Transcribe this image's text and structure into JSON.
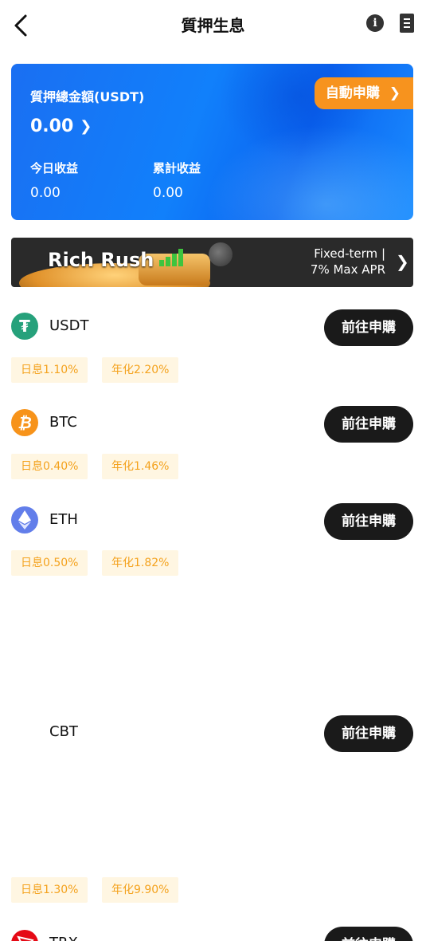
{
  "header": {
    "title": "質押生息"
  },
  "summary": {
    "total_label": "質押總金額(USDT)",
    "total_value": "0.00",
    "auto_button": "自動申購",
    "today_label": "今日收益",
    "today_value": "0.00",
    "cumulative_label": "累計收益",
    "cumulative_value": "0.00"
  },
  "banner": {
    "title": "Rich Rush",
    "line1": "Fixed-term |",
    "line2": "7% Max APR"
  },
  "coins": [
    {
      "name": "USDT",
      "icon": "tether-icon",
      "icon_color": "#26a17b",
      "button": "前往申購",
      "daily": "日息1.10%",
      "annual": "年化2.20%"
    },
    {
      "name": "BTC",
      "icon": "bitcoin-icon",
      "icon_color": "#f7931a",
      "button": "前往申購",
      "daily": "日息0.40%",
      "annual": "年化1.46%"
    },
    {
      "name": "ETH",
      "icon": "ethereum-icon",
      "icon_color": "#627eea",
      "button": "前往申購",
      "daily": "日息0.50%",
      "annual": "年化1.82%"
    },
    {
      "name": "CBT",
      "button": "前往申購",
      "daily": "日息1.30%",
      "annual": "年化9.90%"
    },
    {
      "name": "TRX",
      "icon": "tron-icon",
      "icon_color": "#e50915",
      "button": "前往申購"
    }
  ],
  "colors": {
    "brand_blue": "#1180fb",
    "accent_orange": "#f7931e",
    "tag_bg": "#fff6e2",
    "tag_text": "#f4a21d",
    "button_dark": "#1a1a1a"
  }
}
